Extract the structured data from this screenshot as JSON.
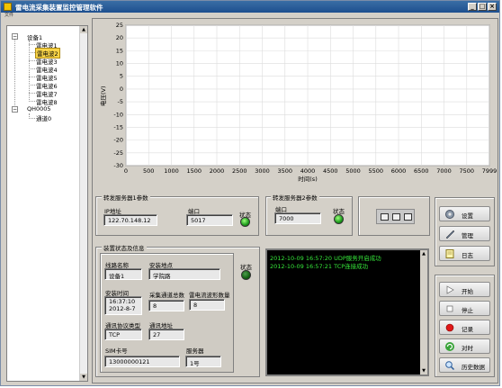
{
  "window": {
    "title": "雷电流采集装置监控管理软件",
    "menu": "文件"
  },
  "tree": {
    "items": [
      {
        "label": "设备1",
        "level": 0,
        "expanded": true
      },
      {
        "label": "雷电波1",
        "level": 1
      },
      {
        "label": "雷电波2",
        "level": 1,
        "selected": true
      },
      {
        "label": "雷电波3",
        "level": 1
      },
      {
        "label": "雷电波4",
        "level": 1
      },
      {
        "label": "雷电波5",
        "level": 1
      },
      {
        "label": "雷电波6",
        "level": 1
      },
      {
        "label": "雷电波7",
        "level": 1
      },
      {
        "label": "雷电波8",
        "level": 1
      },
      {
        "label": "QH0005",
        "level": 0,
        "expanded": true
      },
      {
        "label": "通道0",
        "level": 1
      }
    ]
  },
  "chart_data": {
    "type": "line",
    "ylabel": "电压(V)",
    "xlabel": "时间(s)",
    "xlim": [
      0,
      7999
    ],
    "ylim": [
      -30,
      25
    ],
    "xticks": [
      0,
      500,
      1000,
      1500,
      2000,
      2500,
      3000,
      3500,
      4000,
      4500,
      5000,
      5500,
      6000,
      6500,
      7000,
      7500,
      7999
    ],
    "yticks": [
      25,
      20,
      15,
      10,
      5,
      0,
      -5,
      -10,
      -15,
      -20,
      -25,
      -30
    ],
    "grid": true,
    "series": []
  },
  "server1": {
    "title": "转发服务器1参数",
    "ip_label": "IP地址",
    "ip_value": "122.70.148.12",
    "port_label": "端口",
    "port_value": "5017",
    "status_label": "状态"
  },
  "server2": {
    "title": "转发服务器2参数",
    "port_label": "端口",
    "port_value": "7000",
    "status_label": "状态"
  },
  "device": {
    "title": "装置状态及信息",
    "status_label": "状态",
    "line_name_label": "线路名称",
    "line_name_value": "设备1",
    "location_label": "安装地点",
    "location_value": "学院路",
    "install_time_label": "安装时间",
    "install_time_value_1": "16:37:10",
    "install_time_value_2": "2012-8-7",
    "channels_label": "采集通道总数",
    "channels_value": "8",
    "fluid_label": "雷电流波形数量",
    "fluid_value": "8",
    "protocol_label": "通讯协议类型",
    "protocol_value": "TCP",
    "address_label": "通讯地址",
    "address_value": "27",
    "sim_label": "SIM卡号",
    "sim_value": "13000000121",
    "server_label": "服务器",
    "server_value": "1号"
  },
  "log": {
    "lines": [
      "2012-10-09 16:57:20 UDP服务开启成功",
      "2012-10-09 16:57:21 TCP连接成功"
    ]
  },
  "buttons": {
    "settings": "设置",
    "manage": "管理",
    "log": "日志",
    "start": "开始",
    "stop": "停止",
    "record": "记录",
    "sync": "对时",
    "history": "历史数据"
  },
  "colors": {
    "log_text": "#36e83a",
    "led_on": "#2bd42b",
    "tree_selected": "#f8d448"
  }
}
